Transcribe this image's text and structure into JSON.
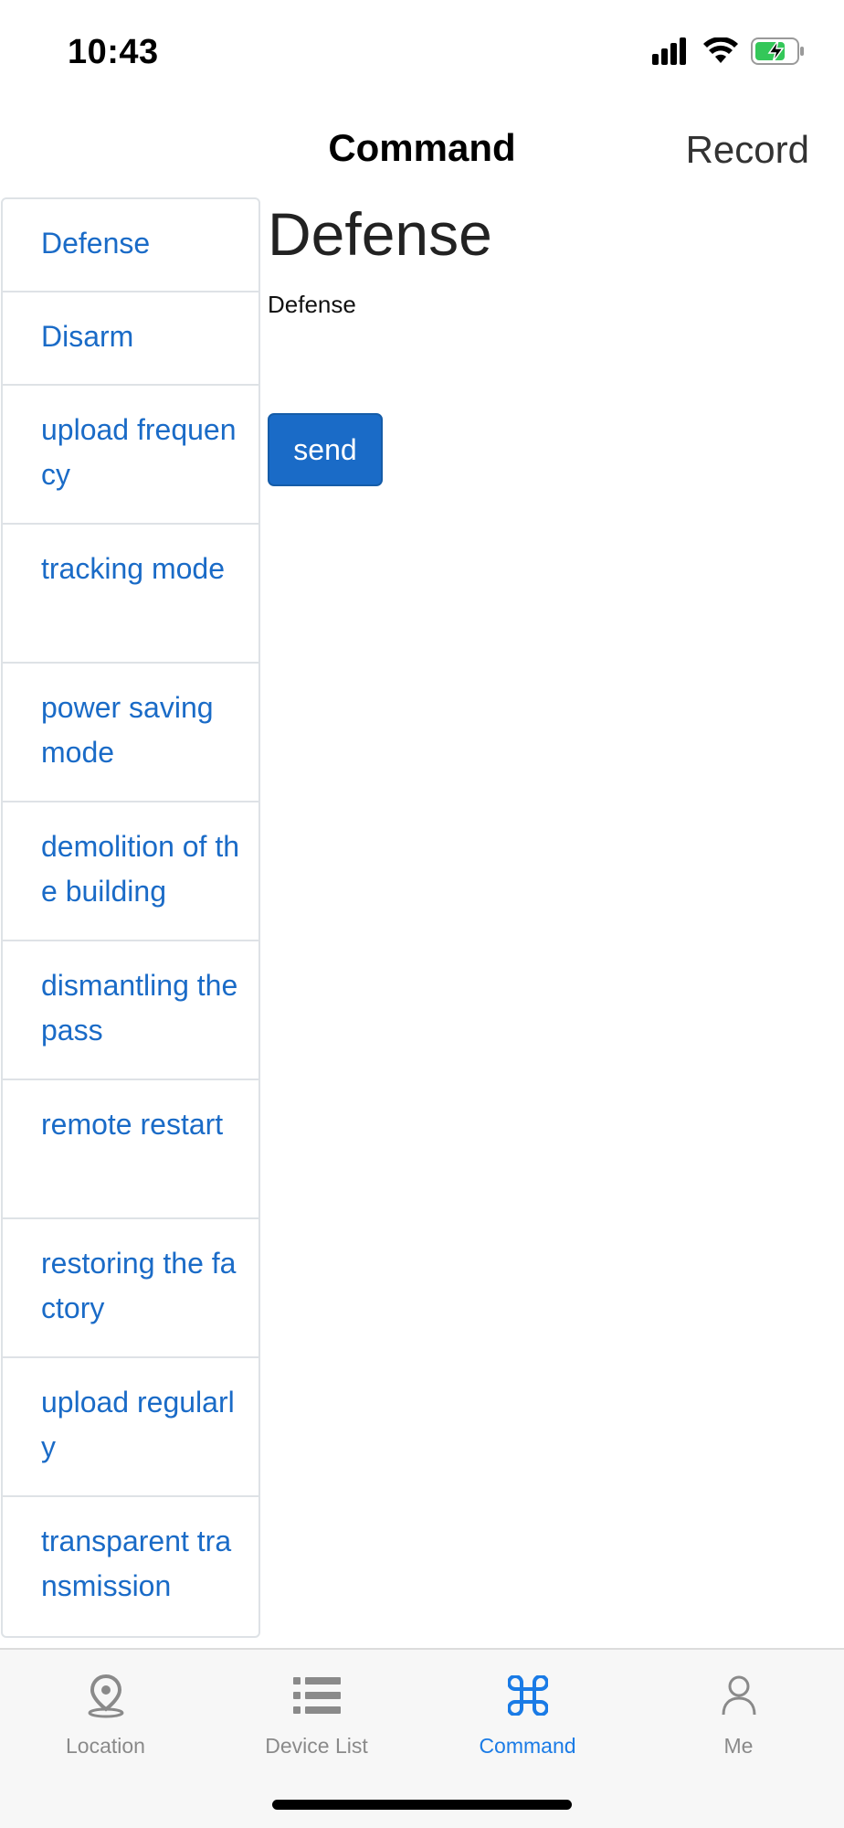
{
  "status_bar": {
    "time": "10:43",
    "icons": [
      "signal-icon",
      "wifi-icon",
      "battery-charging-icon"
    ],
    "battery_color": "#34c759"
  },
  "header": {
    "title": "Command",
    "record_label": "Record"
  },
  "commands": [
    {
      "label": "Defense"
    },
    {
      "label": "Disarm"
    },
    {
      "label": "upload frequency"
    },
    {
      "label": "tracking mode"
    },
    {
      "label": "power saving mode"
    },
    {
      "label": "demolition of the building"
    },
    {
      "label": "dismantling the pass"
    },
    {
      "label": "remote restart"
    },
    {
      "label": "restoring the factory"
    },
    {
      "label": "upload regularly"
    },
    {
      "label": "transparent transmission"
    }
  ],
  "detail": {
    "title": "Defense",
    "description": "Defense",
    "send_label": "send"
  },
  "tab_bar": {
    "tabs": [
      {
        "label": "Location",
        "icon": "location-pin-icon",
        "active": false
      },
      {
        "label": "Device List",
        "icon": "list-icon",
        "active": false
      },
      {
        "label": "Command",
        "icon": "command-icon",
        "active": true
      },
      {
        "label": "Me",
        "icon": "person-icon",
        "active": false
      }
    ],
    "active_color": "#1a7be6",
    "inactive_color": "#8a8a8a"
  },
  "colors": {
    "link_blue": "#1a6bc7",
    "button_blue": "#1a6bc7"
  }
}
